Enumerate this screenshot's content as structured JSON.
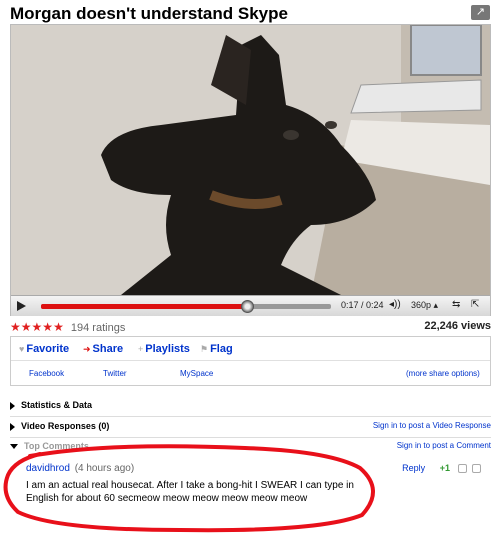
{
  "page": {
    "title": "Morgan doesn't understand Skype"
  },
  "player": {
    "elapsed": "0:17",
    "duration": "0:24",
    "time_label": "0:17 / 0:24",
    "progress_fraction": 0.71,
    "quality_label": "360p"
  },
  "stats": {
    "rating_stars": 5,
    "ratings_label": "194 ratings",
    "views_label": "22,246 views"
  },
  "actions": {
    "favorite": "Favorite",
    "share": "Share",
    "playlists": "Playlists",
    "flag": "Flag"
  },
  "share": {
    "facebook": "Facebook",
    "twitter": "Twitter",
    "myspace": "MySpace",
    "more": "(more share options)"
  },
  "sections": {
    "stats_data": "Statistics & Data",
    "video_responses": "Video Responses (0)",
    "video_responses_link": "Sign in to post a Video Response",
    "top_comments": "Top Comments",
    "comment_link": "Sign in to post a Comment"
  },
  "comment": {
    "author": "davidhrod",
    "time": "(4 hours ago)",
    "body": "I am an actual real housecat. After I take a bong-hit I SWEAR I can type in English for about 60 secmeow meow meow meow meow meow",
    "reply_label": "Reply",
    "score": "+1"
  },
  "colors": {
    "link": "#0033cc",
    "accent_red": "#d11111",
    "highlight_ring": "#e8101a"
  },
  "icons": {
    "popout": "popout-arrow-icon",
    "play": "play-icon",
    "volume": "volume-icon",
    "fullscreen": "fullscreen-icon"
  }
}
